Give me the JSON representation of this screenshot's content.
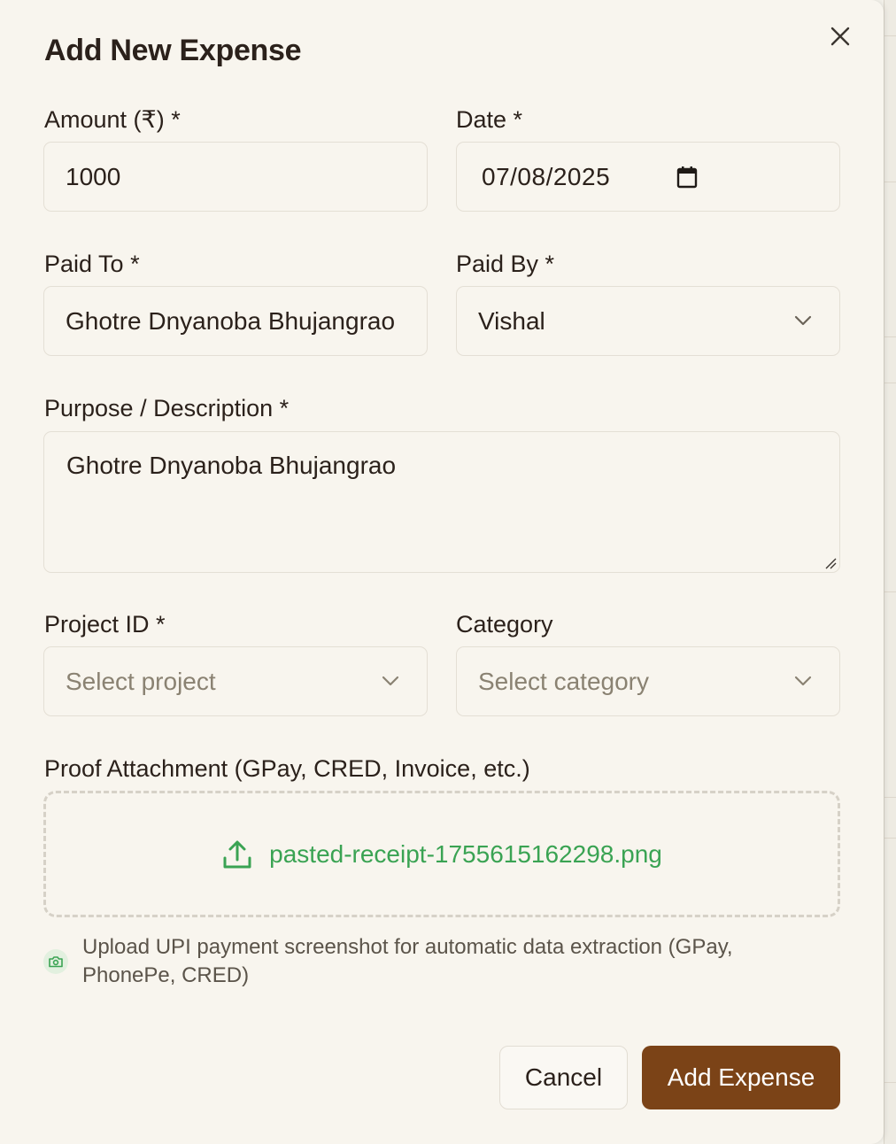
{
  "dialog": {
    "title": "Add New Expense"
  },
  "form": {
    "amount": {
      "label": "Amount (₹) *",
      "value": "1000"
    },
    "date": {
      "label": "Date *",
      "value": "07/08/2025"
    },
    "paid_to": {
      "label": "Paid To *",
      "value": "Ghotre Dnyanoba Bhujangrao"
    },
    "paid_by": {
      "label": "Paid By *",
      "value": "Vishal"
    },
    "purpose": {
      "label": "Purpose / Description *",
      "value": "Ghotre Dnyanoba Bhujangrao"
    },
    "project_id": {
      "label": "Project ID *",
      "placeholder": "Select project"
    },
    "category": {
      "label": "Category",
      "placeholder": "Select category"
    },
    "proof": {
      "label": "Proof Attachment (GPay, CRED, Invoice, etc.)",
      "file_name": "pasted-receipt-1755615162298.png",
      "hint": "Upload UPI payment screenshot for automatic data extraction (GPay, PhonePe, CRED)"
    }
  },
  "actions": {
    "cancel_label": "Cancel",
    "submit_label": "Add Expense"
  },
  "icons": {
    "close": "close-icon",
    "calendar": "calendar-icon",
    "chevron": "chevron-down-icon",
    "upload": "upload-icon",
    "camera": "camera-icon"
  },
  "colors": {
    "background": "#f8f5ee",
    "primary_button": "#7b4317",
    "file_name_text": "#3aa353",
    "border": "#e4dfd5"
  }
}
